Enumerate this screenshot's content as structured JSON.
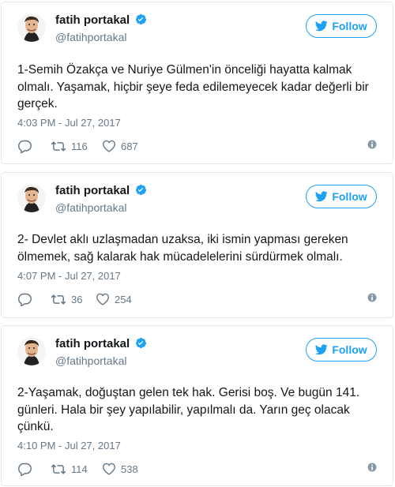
{
  "colors": {
    "accent": "#1da1f2",
    "text": "#14171a",
    "muted": "#657786",
    "border": "#e1e8ed"
  },
  "icons": {
    "verified": "verified-badge-icon",
    "follow": "twitter-bird-icon",
    "reply": "reply-icon",
    "retweet": "retweet-icon",
    "like": "heart-icon",
    "info": "info-icon"
  },
  "tweets": [
    {
      "display_name": "fatih portakal",
      "handle": "@fatihportakal",
      "follow_label": "Follow",
      "text": "1-Semih Özakça ve Nuriye Gülmen'in önceliği hayatta kalmak olmalı. Yaşamak, hiçbir şeye feda edilemeyecek kadar değerli bir gerçek.",
      "timestamp": "4:03 PM - Jul 27, 2017",
      "retweets": "116",
      "likes": "687"
    },
    {
      "display_name": "fatih portakal",
      "handle": "@fatihportakal",
      "follow_label": "Follow",
      "text": "2- Devlet aklı uzlaşmadan uzaksa, iki ismin yapması gereken ölmemek, sağ kalarak hak mücadelelerini sürdürmek olmalı.",
      "timestamp": "4:07 PM - Jul 27, 2017",
      "retweets": "36",
      "likes": "254"
    },
    {
      "display_name": "fatih portakal",
      "handle": "@fatihportakal",
      "follow_label": "Follow",
      "text": "2-Yaşamak, doğuştan gelen tek hak. Gerisi boş. Ve bugün 141. günleri. Hala bir şey yapılabilir, yapılmalı da. Yarın geç olacak çünkü.",
      "timestamp": "4:10 PM - Jul 27, 2017",
      "retweets": "114",
      "likes": "538"
    }
  ]
}
